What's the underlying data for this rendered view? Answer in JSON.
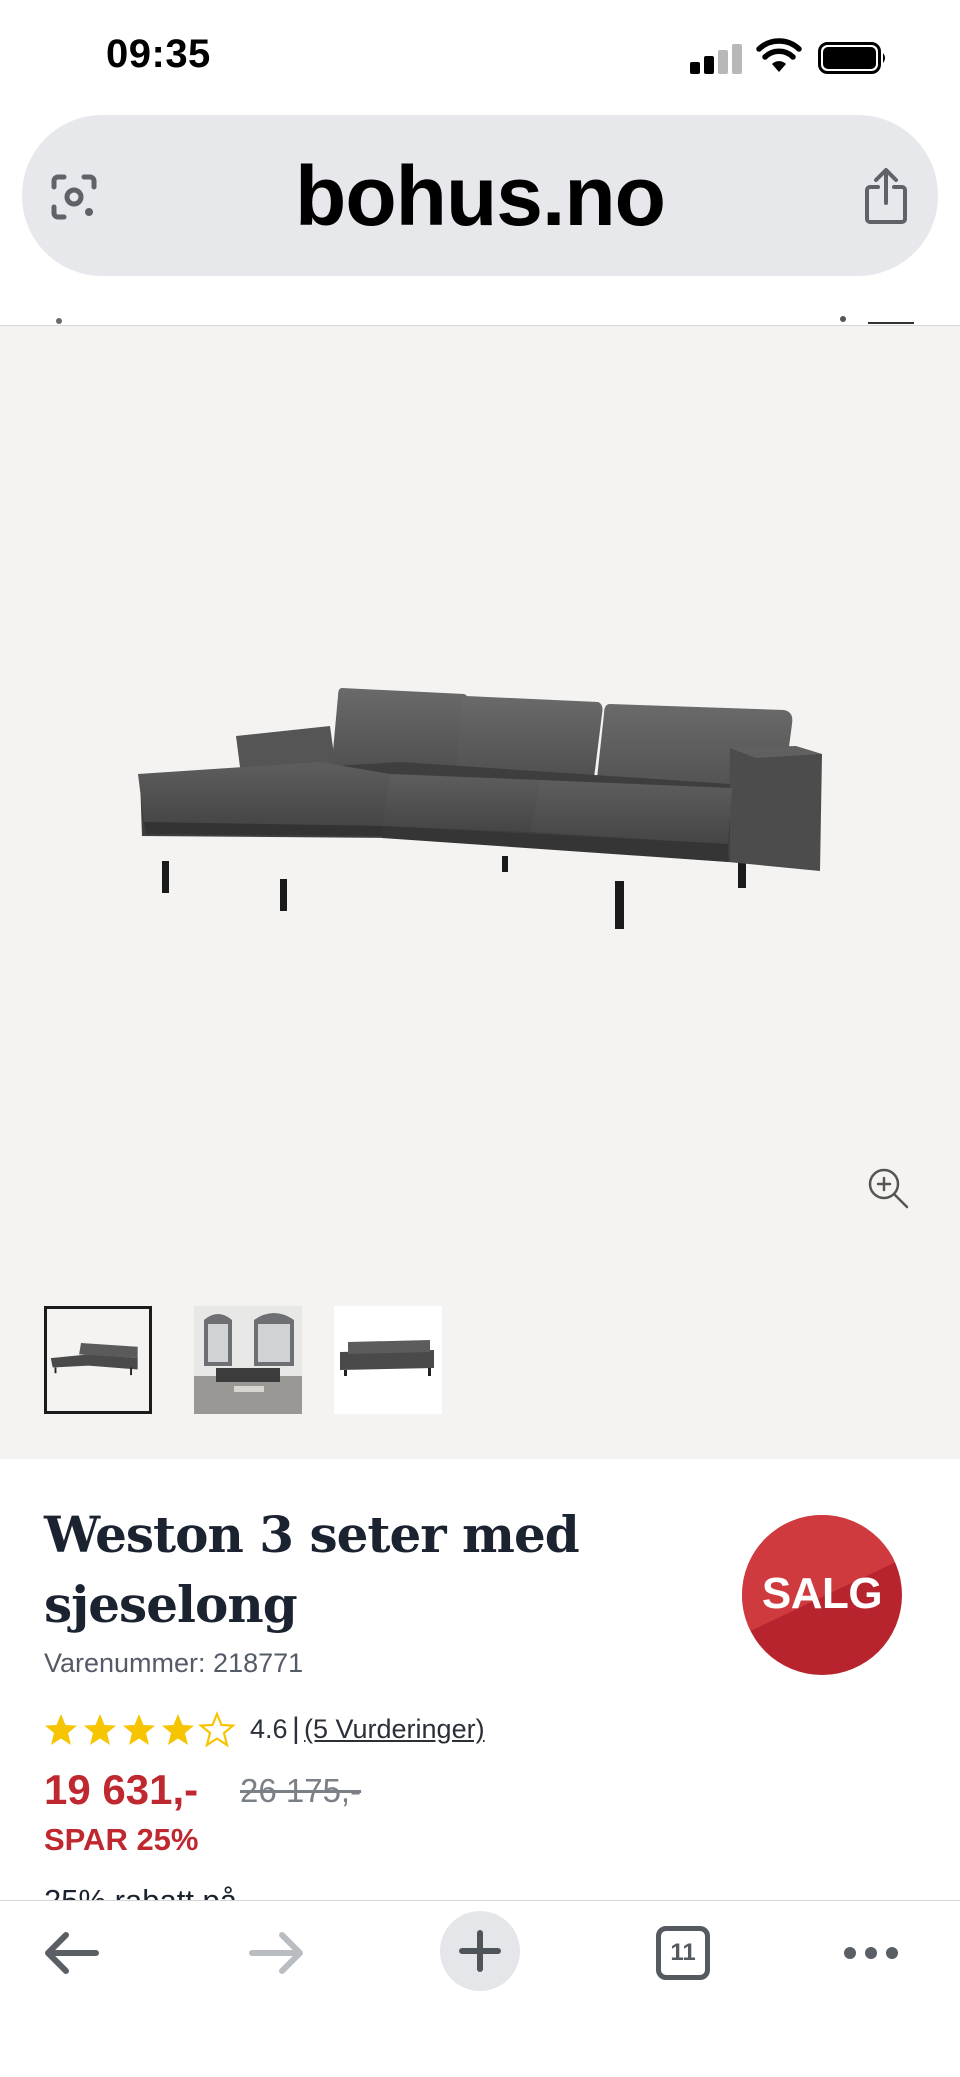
{
  "status_bar": {
    "time": "09:35"
  },
  "browser": {
    "url": "bohus.no",
    "left_icon": "google-lens-icon",
    "right_icon": "share-icon"
  },
  "gallery": {
    "main_image": "grey-leather-sofa-with-chaise",
    "zoom_icon": "zoom-in-icon",
    "thumbnails": [
      {
        "label": "sofa-front-view",
        "selected": true
      },
      {
        "label": "sofa-living-room-view",
        "selected": false
      },
      {
        "label": "sofa-side-view",
        "selected": false
      }
    ]
  },
  "product": {
    "title": "Weston 3 seter med sjeselong",
    "sku": "Varenummer: 218771",
    "rating_value": "4.6",
    "rating_separator": "|",
    "rating_count": "(5 Vurderinger)",
    "rating_stars": 4.5,
    "price": "19 631,-",
    "old_price": "26 175,-",
    "save_label": "SPAR 25%",
    "sale_badge": "SALG",
    "peek_text": "25% rabatt på"
  },
  "toolbar": {
    "back_icon": "back-arrow-icon",
    "forward_icon": "forward-arrow-icon",
    "new_tab_icon": "plus-icon",
    "tabs_count": "11",
    "more_icon": "more-dots-icon"
  },
  "colors": {
    "accent_red": "#c0282f",
    "star_yellow": "#f6c400",
    "gallery_bg": "#f4f3f1",
    "url_bar_bg": "#e6e8ec"
  }
}
